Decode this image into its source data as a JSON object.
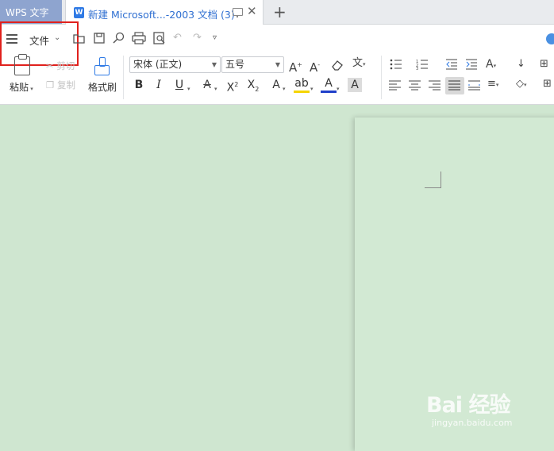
{
  "tabs": {
    "home_label": "WPS 文字",
    "doc_title": "新建 Microsoft...-2003 文档 (3)",
    "close_glyph": "✕",
    "add_glyph": "+"
  },
  "file_menu": {
    "label": "文件"
  },
  "clipboard": {
    "paste": "粘贴",
    "cut": "剪切",
    "copy": "复制",
    "format_painter": "格式刷"
  },
  "font": {
    "family": "宋体 (正文)",
    "size": "五号"
  },
  "watermark": {
    "brand": "Bai 经验",
    "url": "jingyan.baidu.com"
  },
  "colors": {
    "accent": "#2f7ae5",
    "highlight_box": "#e0211d",
    "canvas": "#cfe6d0",
    "home_tab": "#8ea4cf"
  }
}
